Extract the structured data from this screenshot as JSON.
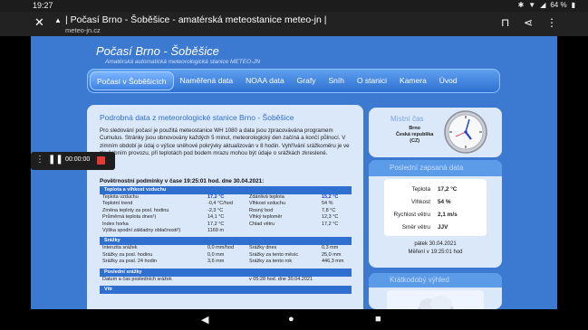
{
  "status_bar": {
    "time": "19:27",
    "battery": "64 %"
  },
  "tab": {
    "title": "| Počasí Brno - Šoběšice - amatérská meteostanice meteo-jn |",
    "url": "meteo-jn.cz"
  },
  "site": {
    "title": "Počasí Brno - Šoběšice",
    "subtitle": "Amatérská automatická meteorologická stanice METEO-JN"
  },
  "nav": [
    "Počasí v Šoběšicích",
    "Naměřená data",
    "NOAA data",
    "Grafy",
    "Sníh",
    "O stanici",
    "Kamera",
    "Úvod"
  ],
  "content": {
    "heading": "Podrobná data z meteorologické stanice Brno - Šoběšice",
    "intro": "Pro sledování počasí je použitá meteostanice WH 1080 a data jsou zpracovávána programem Cumulus. Stránky jsou obnovovány každých 5 minut, meteorologický den začíná a končí půlnocí. V zimním období je údaj o výšce sněhové pokrývky aktualizován v 8 hodin. Vyhřívání srážkoměru je ve zkušebním provozu, při teplotách pod bodem mrazu mohou být údaje o srážkách zkreslené.",
    "conditions": "Povětrnostní podmínky v čase 19:25:01 hod. dne 30.04.2021:"
  },
  "sections": {
    "temp": {
      "title": "Teplota a vlhkost vzduchu",
      "rows": [
        [
          "Teplota vzduchu",
          "17,2 °C",
          "Zdánlivá teplota",
          "15,2 °C"
        ],
        [
          "Teplotní trend",
          "-0,4 °C/hod",
          "Vlhkost vzduchu",
          "54 %"
        ],
        [
          "Změna teploty za posl. hodinu",
          "-2,3 °C",
          "Rosný bod",
          "7,8 °C"
        ],
        [
          "Průměrná teplota dnes¹)",
          "14,1 °C",
          "Vlhký teploměr",
          "12,3 °C"
        ],
        [
          "Index horka",
          "17,2 °C",
          "Chlad větru",
          "17,2 °C"
        ],
        [
          "Výška spodní základny oblačnosti²)",
          "1169 m",
          "",
          ""
        ]
      ]
    },
    "rain": {
      "title": "Srážky",
      "rows": [
        [
          "Intenzita srážek",
          "0,0 mm/hod",
          "Srážky dnes",
          "0,3 mm"
        ],
        [
          "Srážky za posl. hodinu",
          "0,0 mm",
          "Srážky za tento měsíc",
          "25,0 mm"
        ],
        [
          "Srážky za posl. 24 hodin",
          "3,6 mm",
          "Srážky za tento rok",
          "446,3 mm"
        ]
      ]
    },
    "last": {
      "title": "Poslední srážky",
      "rows": [
        [
          "Datum a čas posledních srážek",
          "",
          "v 05:28 hod. dne 30.04.2021",
          ""
        ]
      ]
    },
    "wind": {
      "title": "Vítr"
    }
  },
  "clock_panel": {
    "label": "Místní čas",
    "city": "Brno",
    "country": "Česká republika",
    "code": "(CZ)"
  },
  "weather_panel": {
    "title": "Poslední zapsaná data",
    "rows": [
      {
        "k": "Teplota",
        "v": "17,2 °C"
      },
      {
        "k": "Vlhkost",
        "v": "54 %"
      },
      {
        "k": "Rychlost větru",
        "v": "2,1 m/s"
      },
      {
        "k": "Směr větru",
        "v": "JJV"
      }
    ],
    "date": "pátek 30.04.2021",
    "measured": "Měření v 19:25:01 hod"
  },
  "forecast_panel": {
    "title": "Krátkodobý výhled"
  },
  "recorder": {
    "timer": "00:00:00"
  }
}
